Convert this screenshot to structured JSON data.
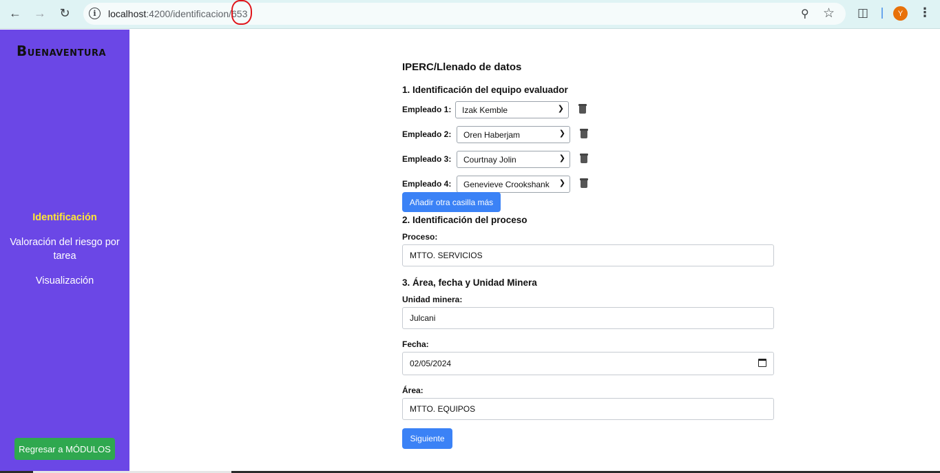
{
  "browser": {
    "url_host": "localhost",
    "url_path": ":4200/identificacion/653",
    "profile_initial": "Y",
    "icons": [
      "back-icon",
      "forward-icon",
      "reload-icon",
      "info-icon",
      "zoom-icon",
      "star-icon",
      "extensions-icon",
      "menu-icon"
    ]
  },
  "sidebar": {
    "logo_initial": "B",
    "logo_rest": "UENAVENTURA",
    "items": [
      {
        "label": "Identificación",
        "active": true
      },
      {
        "label": "Valoración del riesgo por tarea",
        "active": false
      },
      {
        "label": "Visualización",
        "active": false
      }
    ],
    "back_label": "Regresar a MÓDULOS"
  },
  "form": {
    "title": "IPERC/Llenado de datos",
    "section1": "1. Identificación del equipo evaluador",
    "employees": [
      {
        "label": "Empleado 1:",
        "value": "Izak Kemble"
      },
      {
        "label": "Empleado 2:",
        "value": "Oren Haberjam"
      },
      {
        "label": "Empleado 3:",
        "value": "Courtnay Jolin"
      },
      {
        "label": "Empleado 4:",
        "value": "Genevieve Crookshank"
      }
    ],
    "add_label": "Añadir otra casilla más",
    "section2": "2. Identificación del proceso",
    "proceso_label": "Proceso:",
    "proceso_value": "MTTO. SERVICIOS",
    "section3": "3. Área, fecha y Unidad Minera",
    "unidad_label": "Unidad minera:",
    "unidad_value": "Julcani",
    "fecha_label": "Fecha:",
    "fecha_value": "02/05/2024",
    "area_label": "Área:",
    "area_value": "MTTO. EQUIPOS",
    "next_label": "Siguiente"
  },
  "colors": {
    "sidebar": "#6b47e6",
    "active_nav": "#ffe733",
    "primary_button": "#3b82f6",
    "back_button": "#2fa84f"
  }
}
